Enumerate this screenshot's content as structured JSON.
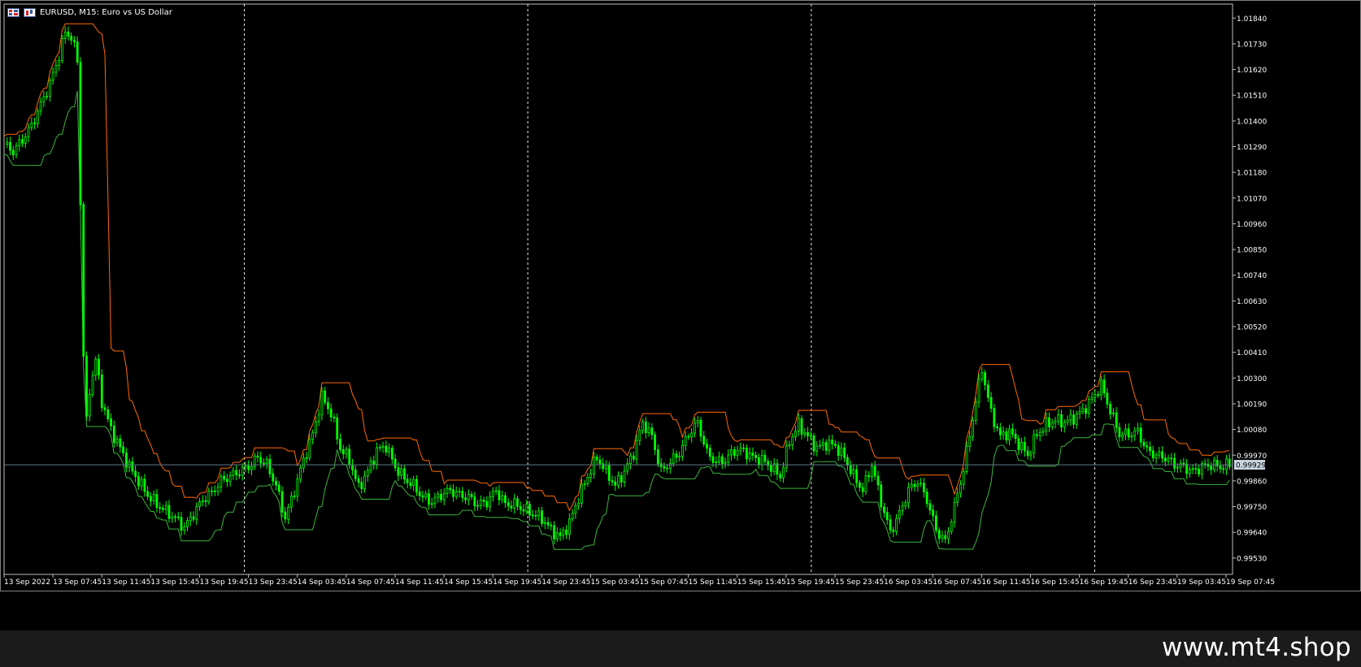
{
  "chart_header": {
    "symbol_text": "EURUSD, M15:  Euro vs US Dollar",
    "icons": [
      "chart-window-icon",
      "candles-icon"
    ]
  },
  "watermark": "www.mt4.shop",
  "colors": {
    "background": "#000000",
    "frame": "#c0c0c0",
    "price_line": "#5f7a89",
    "price_label_bg": "#c9d6df",
    "bullish_candle": "#00ff00",
    "bearish_candle": "#00ff00",
    "upper_band": "#ff6a00",
    "lower_band": "#3ab53a",
    "axis_text": "#ffffff",
    "day_separator": "#ffffff"
  },
  "chart_data": {
    "type": "line",
    "symbol": "EURUSD",
    "timeframe": "M15",
    "ylim": [
      0.9946,
      1.019
    ],
    "ytick_labels": [
      "1.01840",
      "1.01730",
      "1.01620",
      "1.01510",
      "1.01400",
      "1.01290",
      "1.01180",
      "1.01070",
      "1.00960",
      "1.00850",
      "1.00740",
      "1.00630",
      "1.00520",
      "1.00410",
      "1.00300",
      "1.00190",
      "1.00080",
      "0.99970",
      "0.99860",
      "0.99750",
      "0.99640",
      "0.99530"
    ],
    "ytick_values": [
      1.0184,
      1.0173,
      1.0162,
      1.0151,
      1.014,
      1.0129,
      1.0118,
      1.0107,
      1.0096,
      1.0085,
      1.0074,
      1.0063,
      1.0052,
      1.0041,
      1.003,
      1.0019,
      1.0008,
      0.9997,
      0.9986,
      0.9975,
      0.9964,
      0.9953
    ],
    "xtick_labels": [
      "13 Sep 2022",
      "13 Sep 07:45",
      "13 Sep 11:45",
      "13 Sep 15:45",
      "13 Sep 19:45",
      "13 Sep 23:45",
      "14 Sep 03:45",
      "14 Sep 07:45",
      "14 Sep 11:45",
      "14 Sep 15:45",
      "14 Sep 19:45",
      "14 Sep 23:45",
      "15 Sep 03:45",
      "15 Sep 07:45",
      "15 Sep 11:45",
      "15 Sep 15:45",
      "15 Sep 19:45",
      "15 Sep 23:45",
      "16 Sep 03:45",
      "16 Sep 07:45",
      "16 Sep 11:45",
      "16 Sep 15:45",
      "16 Sep 19:45",
      "16 Sep 23:45",
      "19 Sep 03:45",
      "19 Sep 07:45"
    ],
    "day_separators": [
      "13 Sep 23:45",
      "14 Sep 23:45",
      "15 Sep 23:45",
      "16 Sep 23:45"
    ],
    "current_price": 0.99929,
    "current_price_label": "0.99929",
    "series": [
      {
        "role": "price",
        "x_index": [
          0,
          3,
          6,
          9,
          12,
          15,
          18,
          20,
          22,
          24,
          25,
          26,
          27,
          28,
          30,
          32,
          35,
          38,
          41,
          44,
          47,
          50,
          53,
          56,
          59,
          62,
          65,
          68,
          71,
          74,
          77,
          80,
          83,
          86,
          89,
          92,
          95,
          98,
          101,
          104,
          107,
          110,
          113,
          116,
          119,
          122,
          125,
          128,
          131,
          134,
          137,
          140,
          143,
          146,
          149,
          152,
          155,
          158,
          161,
          164,
          167,
          170,
          173,
          176,
          179,
          182,
          185,
          188,
          191,
          194,
          197,
          200,
          203,
          206,
          209,
          212,
          215,
          218,
          221,
          224,
          227,
          230,
          233,
          236,
          239,
          242,
          245,
          248,
          251,
          254,
          257,
          260,
          263,
          266,
          269,
          272,
          275,
          278,
          281,
          284,
          287,
          290,
          293,
          296,
          299,
          302,
          305,
          308,
          311,
          314,
          317,
          320,
          323,
          326,
          329,
          332,
          335,
          338,
          341,
          344,
          347,
          350,
          353,
          356,
          359,
          362,
          365,
          368,
          371,
          374,
          377,
          380,
          383,
          386,
          389,
          392,
          395,
          398,
          401
        ],
        "values": [
          1.013,
          1.0127,
          1.0132,
          1.0138,
          1.0147,
          1.0156,
          1.0168,
          1.0178,
          1.0176,
          1.0166,
          1.0105,
          1.004,
          1.0011,
          1.0025,
          1.0038,
          1.002,
          1.0008,
          1.0,
          0.9992,
          0.9986,
          0.998,
          0.9976,
          0.9973,
          0.997,
          0.9966,
          0.9972,
          0.9978,
          0.9981,
          0.9986,
          0.9988,
          0.999,
          0.9992,
          0.9996,
          0.9993,
          0.9984,
          0.997,
          0.9982,
          0.9995,
          1.0006,
          1.0022,
          1.0015,
          1.0,
          0.9995,
          0.9983,
          0.999,
          0.9999,
          1.0001,
          0.9992,
          0.9987,
          0.9984,
          0.9979,
          0.9977,
          0.998,
          0.9982,
          0.998,
          0.9979,
          0.9976,
          0.9977,
          0.9982,
          0.9976,
          0.9976,
          0.9974,
          0.9972,
          0.997,
          0.9965,
          0.9962,
          0.9968,
          0.9979,
          0.9988,
          0.9996,
          0.999,
          0.9984,
          0.999,
          0.9998,
          1.0011,
          1.0005,
          0.999,
          0.9994,
          0.9998,
          1.0006,
          1.0011,
          0.9998,
          0.9994,
          0.9995,
          0.9999,
          0.9999,
          0.9996,
          0.9995,
          0.9992,
          0.9988,
          1.0003,
          1.001,
          1.0005,
          1.0,
          1.0002,
          1.0001,
          0.9996,
          0.9988,
          0.9982,
          0.9993,
          0.9977,
          0.9964,
          0.9972,
          0.9982,
          0.9986,
          0.9978,
          0.9965,
          0.996,
          0.9975,
          0.9991,
          1.0013,
          1.0034,
          1.0015,
          1.0005,
          1.0007,
          1.0002,
          0.9997,
          1.0006,
          1.001,
          1.0012,
          1.0011,
          1.0013,
          1.0016,
          1.0021,
          1.0027,
          1.0016,
          1.0006,
          1.0006,
          1.0007,
          0.9999,
          0.9997,
          0.9996,
          0.9993,
          0.9992,
          0.999,
          0.9992,
          0.99929,
          0.9992,
          0.99929
        ]
      }
    ]
  }
}
